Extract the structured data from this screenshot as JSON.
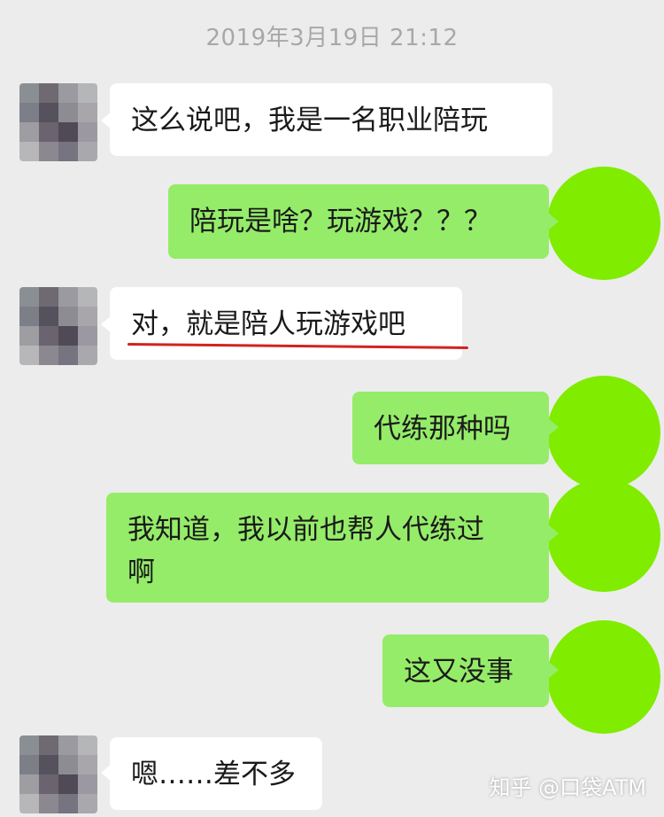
{
  "timestamp": "2019年3月19日 21:12",
  "messages": [
    {
      "side": "in",
      "text": "这么说吧，我是一名职业陪玩"
    },
    {
      "side": "out",
      "text": "陪玩是啥？玩游戏？？？"
    },
    {
      "side": "in",
      "text": "对，就是陪人玩游戏吧"
    },
    {
      "side": "out",
      "text": "代练那种吗"
    },
    {
      "side": "out",
      "text": "我知道，我以前也帮人代练过\n啊"
    },
    {
      "side": "out",
      "text": "这又没事"
    },
    {
      "side": "in",
      "text": "嗯……差不多"
    }
  ],
  "colors": {
    "background": "#ececec",
    "incoming_bubble": "#ffffff",
    "outgoing_bubble": "#95ec69",
    "self_avatar": "#80ec00",
    "underline": "#d2231e"
  },
  "icons": {
    "contact_avatar": "pixelated-avatar-icon",
    "self_avatar": "green-circle-avatar-icon"
  },
  "watermark": "知乎 @口袋ATM"
}
